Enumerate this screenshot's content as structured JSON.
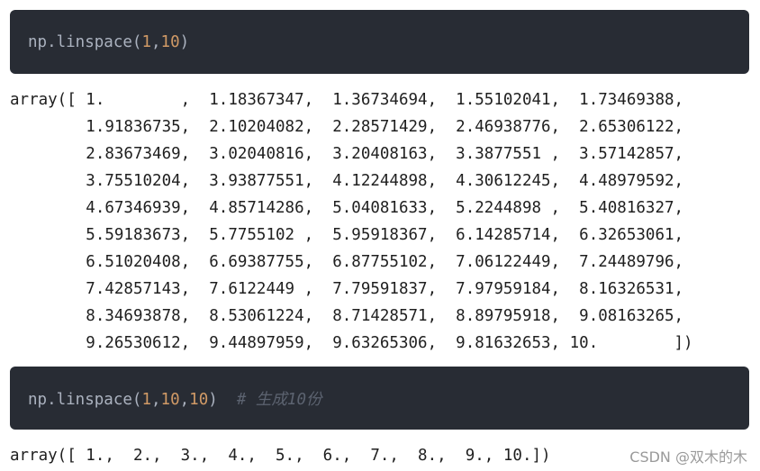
{
  "cell1": {
    "code_prefix": "np.linspace(",
    "arg1": "1",
    "sep1": ",",
    "arg2": "10",
    "code_suffix": ")"
  },
  "output1": {
    "lines": [
      "array([ 1.        ,  1.18367347,  1.36734694,  1.55102041,  1.73469388,",
      "        1.91836735,  2.10204082,  2.28571429,  2.46938776,  2.65306122,",
      "        2.83673469,  3.02040816,  3.20408163,  3.3877551 ,  3.57142857,",
      "        3.75510204,  3.93877551,  4.12244898,  4.30612245,  4.48979592,",
      "        4.67346939,  4.85714286,  5.04081633,  5.2244898 ,  5.40816327,",
      "        5.59183673,  5.7755102 ,  5.95918367,  6.14285714,  6.32653061,",
      "        6.51020408,  6.69387755,  6.87755102,  7.06122449,  7.24489796,",
      "        7.42857143,  7.6122449 ,  7.79591837,  7.97959184,  8.16326531,",
      "        8.34693878,  8.53061224,  8.71428571,  8.89795918,  9.08163265,",
      "        9.26530612,  9.44897959,  9.63265306,  9.81632653, 10.        ])"
    ]
  },
  "cell2": {
    "code_prefix": "np.linspace(",
    "arg1": "1",
    "sep1": ",",
    "arg2": "10",
    "sep2": ",",
    "arg3": "10",
    "code_suffix": ")  ",
    "comment": "# 生成10份"
  },
  "output2": {
    "text": "array([ 1.,  2.,  3.,  4.,  5.,  6.,  7.,  8.,  9., 10.])"
  },
  "watermark": "CSDN @双木的木"
}
